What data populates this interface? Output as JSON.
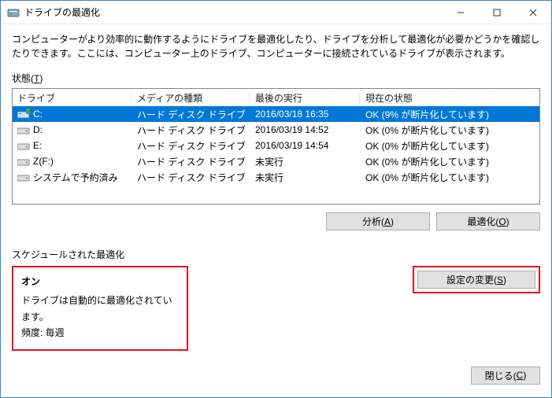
{
  "window": {
    "title": "ドライブの最適化"
  },
  "description": "コンピューターがより効率的に動作するようにドライブを最適化したり、ドライブを分析して最適化が必要かどうかを確認したりできます。ここには、コンピューター上のドライブ、コンピューターに接続されているドライブが表示されます。",
  "status_label": "状態(",
  "status_hotkey": "T",
  "status_label_close": ")",
  "columns": {
    "drive": "ドライブ",
    "media": "メディアの種類",
    "last": "最後の実行",
    "state": "現在の状態"
  },
  "rows": [
    {
      "icon": "drive-main",
      "name": "C:",
      "media": "ハード ディスク ドライブ",
      "last": "2016/03/18 16:35",
      "state": "OK (9% が断片化しています)",
      "selected": true
    },
    {
      "icon": "drive-hdd",
      "name": "D:",
      "media": "ハード ディスク ドライブ",
      "last": "2016/03/19 14:52",
      "state": "OK (0% が断片化しています)",
      "selected": false
    },
    {
      "icon": "drive-hdd",
      "name": "E:",
      "media": "ハード ディスク ドライブ",
      "last": "2016/03/19 14:54",
      "state": "OK (0% が断片化しています)",
      "selected": false
    },
    {
      "icon": "drive-hdd",
      "name": "Z(F:)",
      "media": "ハード ディスク ドライブ",
      "last": "未実行",
      "state": "OK (0% が断片化しています)",
      "selected": false
    },
    {
      "icon": "drive-hdd",
      "name": "システムで予約済み",
      "media": "ハード ディスク ドライブ",
      "last": "未実行",
      "state": "OK (0% が断片化しています)",
      "selected": false
    }
  ],
  "buttons": {
    "analyze": "分析(",
    "analyze_hotkey": "A",
    "analyze_close": ")",
    "optimize": "最適化(",
    "optimize_hotkey": "O",
    "optimize_close": ")",
    "change": "設定の変更(",
    "change_hotkey": "S",
    "change_close": ")",
    "close": "閉じる(",
    "close_hotkey": "C",
    "close_close": ")"
  },
  "schedule": {
    "label": "スケジュールされた最適化",
    "on": "オン",
    "desc": "ドライブは自動的に最適化されています。",
    "freq": "頻度: 毎週"
  }
}
